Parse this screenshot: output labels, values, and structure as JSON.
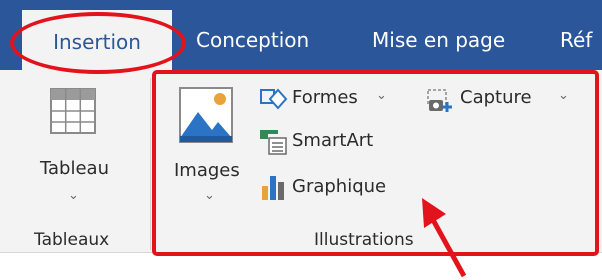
{
  "tabs": {
    "active": "Insertion",
    "items": [
      "Conception",
      "Mise en page",
      "Réf"
    ]
  },
  "groups": {
    "tableaux": {
      "button_label": "Tableau",
      "group_label": "Tableaux"
    },
    "illustrations": {
      "images_label": "Images",
      "formes_label": "Formes",
      "capture_label": "Capture",
      "smartart_label": "SmartArt",
      "graphique_label": "Graphique",
      "group_label": "Illustrations"
    }
  },
  "icons": {
    "table": "table-icon",
    "images": "picture-icon",
    "formes": "shapes-icon",
    "capture": "screenshot-icon",
    "smartart": "smartart-icon",
    "graphique": "bar-chart-icon",
    "dropdown": "chevron-down-icon",
    "annotation_arrow": "arrow-icon"
  },
  "colors": {
    "tab_bar": "#2b579a",
    "ribbon": "#f3f3f3",
    "annotation": "#e3131b",
    "image_icon_blue": "#2a73c5",
    "smartart_green": "#2e8b57",
    "chart_orange": "#e8a33c"
  }
}
